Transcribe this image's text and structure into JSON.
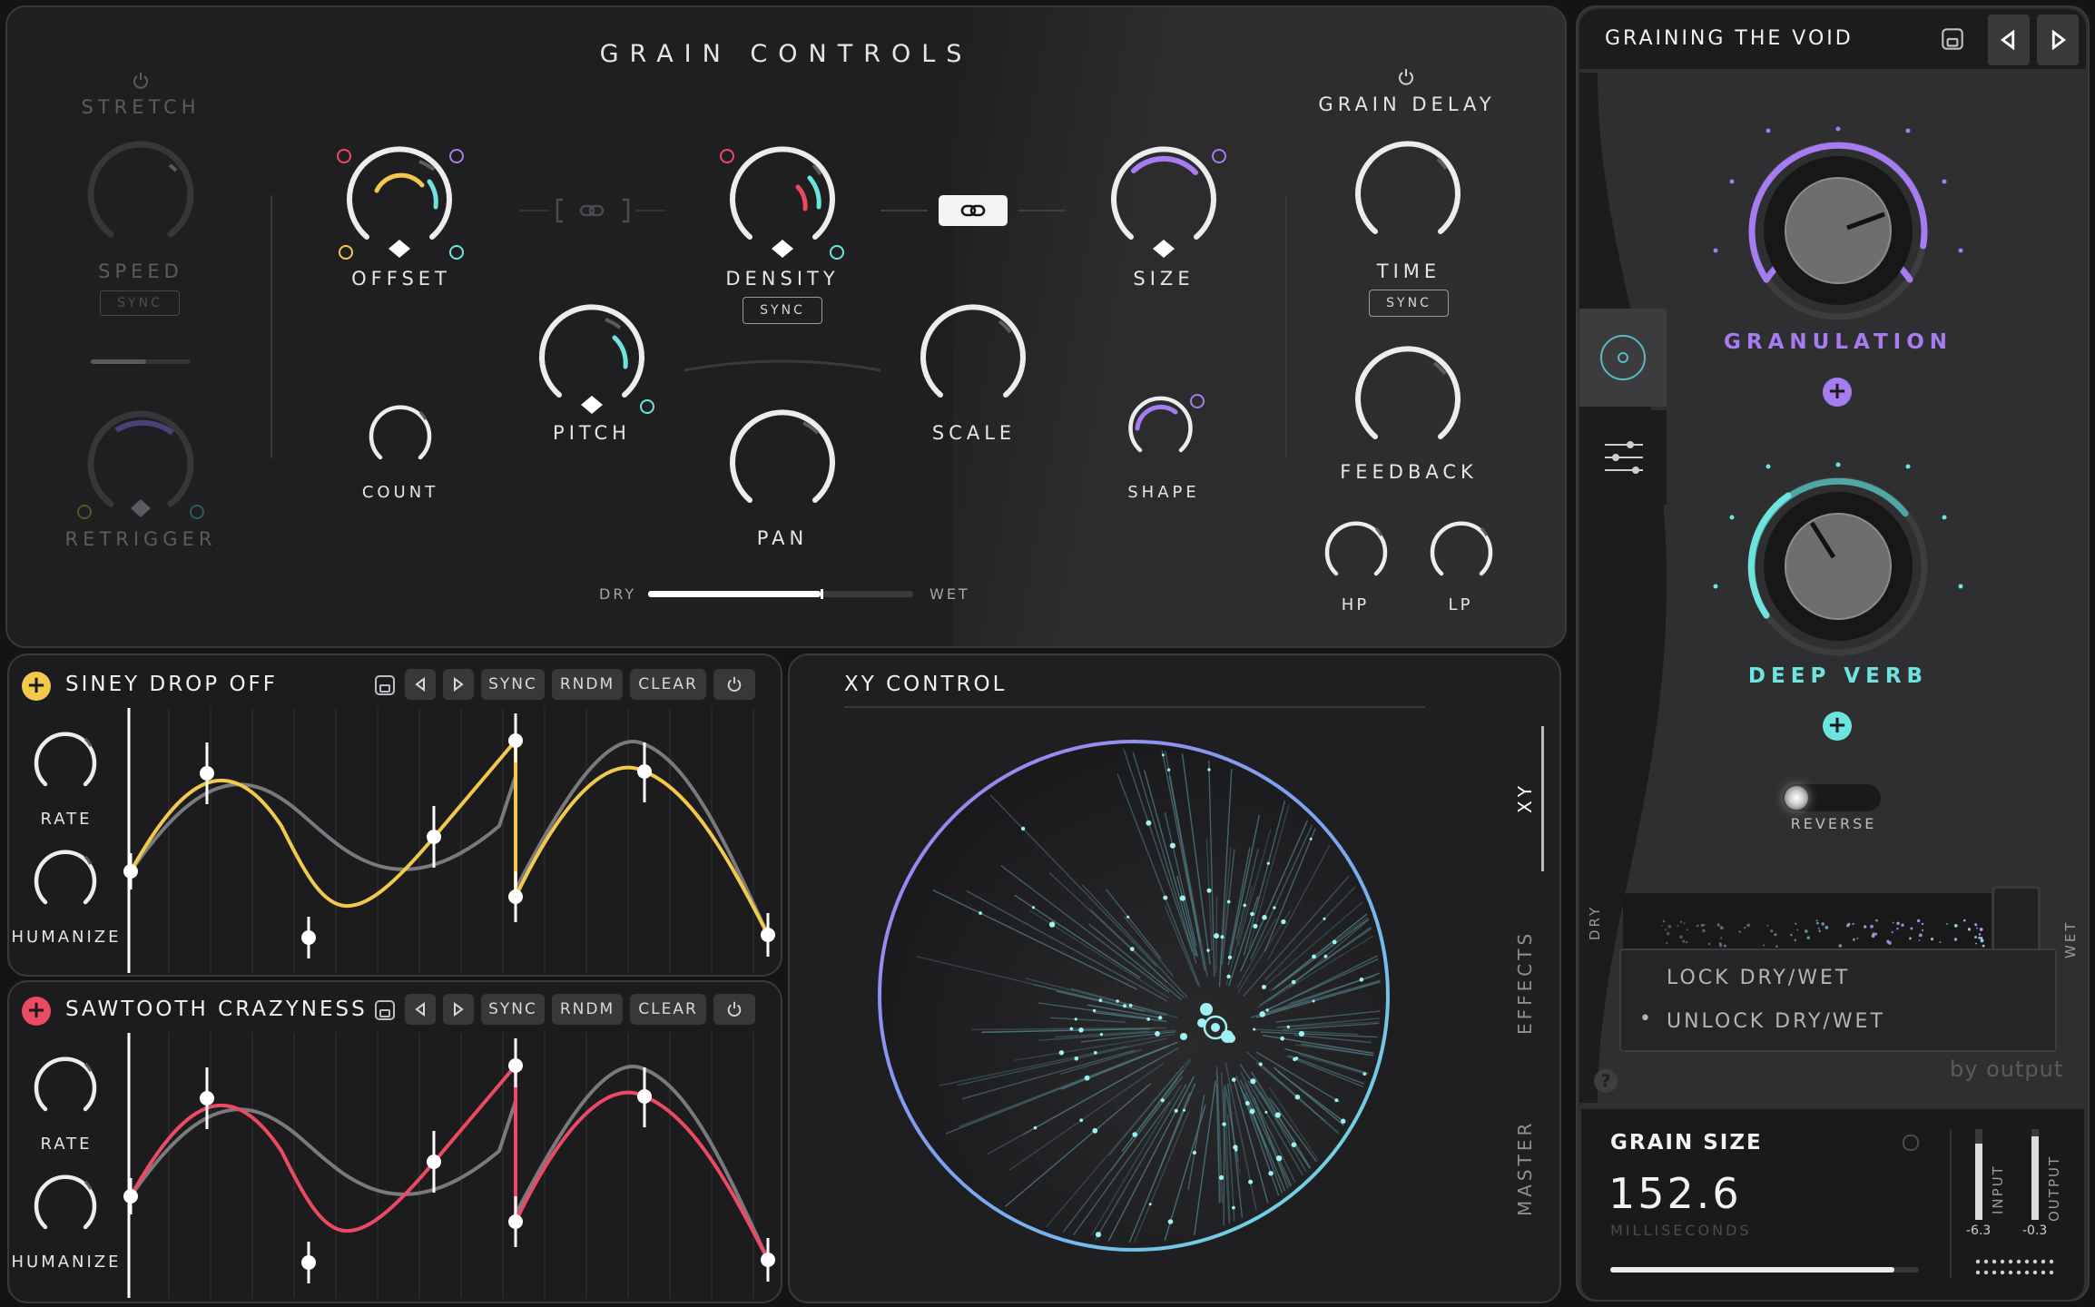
{
  "grain": {
    "title": "GRAIN CONTROLS",
    "stretch": "STRETCH",
    "speed": "SPEED",
    "retrigger": "RETRIGGER",
    "offset": "OFFSET",
    "count": "COUNT",
    "pitch": "PITCH",
    "density": "DENSITY",
    "pan": "PAN",
    "scale": "SCALE",
    "size": "SIZE",
    "shape": "SHAPE",
    "sync": "SYNC",
    "dry": "DRY",
    "wet": "WET",
    "dry_wet_fraction": 0.65,
    "grain_delay": "GRAIN DELAY",
    "time": "TIME",
    "feedback": "FEEDBACK",
    "hp": "HP",
    "lp": "LP"
  },
  "preset": {
    "name": "GRAINING THE VOID",
    "granulation": "GRANULATION",
    "deep_verb": "DEEP VERB",
    "reverse": "REVERSE",
    "dry": "DRY",
    "wet": "WET",
    "menu": [
      "LOCK DRY/WET",
      "UNLOCK DRY/WET"
    ],
    "selected_menu": "UNLOCK DRY/WET",
    "bullet": "•",
    "brand": "by output",
    "help": "?"
  },
  "readout": {
    "param": "GRAIN SIZE",
    "value": "152.6",
    "unit": "MILLISECONDS",
    "value_fraction": 0.92,
    "input_label": "INPUT",
    "output_label": "OUTPUT",
    "input_db": "-6.3",
    "output_db": "-0.3"
  },
  "mod1": {
    "name": "SINEY DROP OFF",
    "color": "#f2c94c",
    "rate": "RATE",
    "humanize": "HUMANIZE"
  },
  "mod2": {
    "name": "SAWTOOTH CRAZYNESS",
    "color": "#ec4a63",
    "rate": "RATE",
    "humanize": "HUMANIZE"
  },
  "toolbar": {
    "sync": "SYNC",
    "rndm": "RNDM",
    "clear": "CLEAR"
  },
  "xy": {
    "title": "XY CONTROL",
    "tabs": [
      "XY",
      "EFFECTS",
      "MASTER"
    ],
    "active_tab": "XY"
  },
  "colors": {
    "purple": "#a77cf0",
    "cyan": "#6fe3e0",
    "yellow": "#f2c94c",
    "red": "#ec4a63"
  }
}
